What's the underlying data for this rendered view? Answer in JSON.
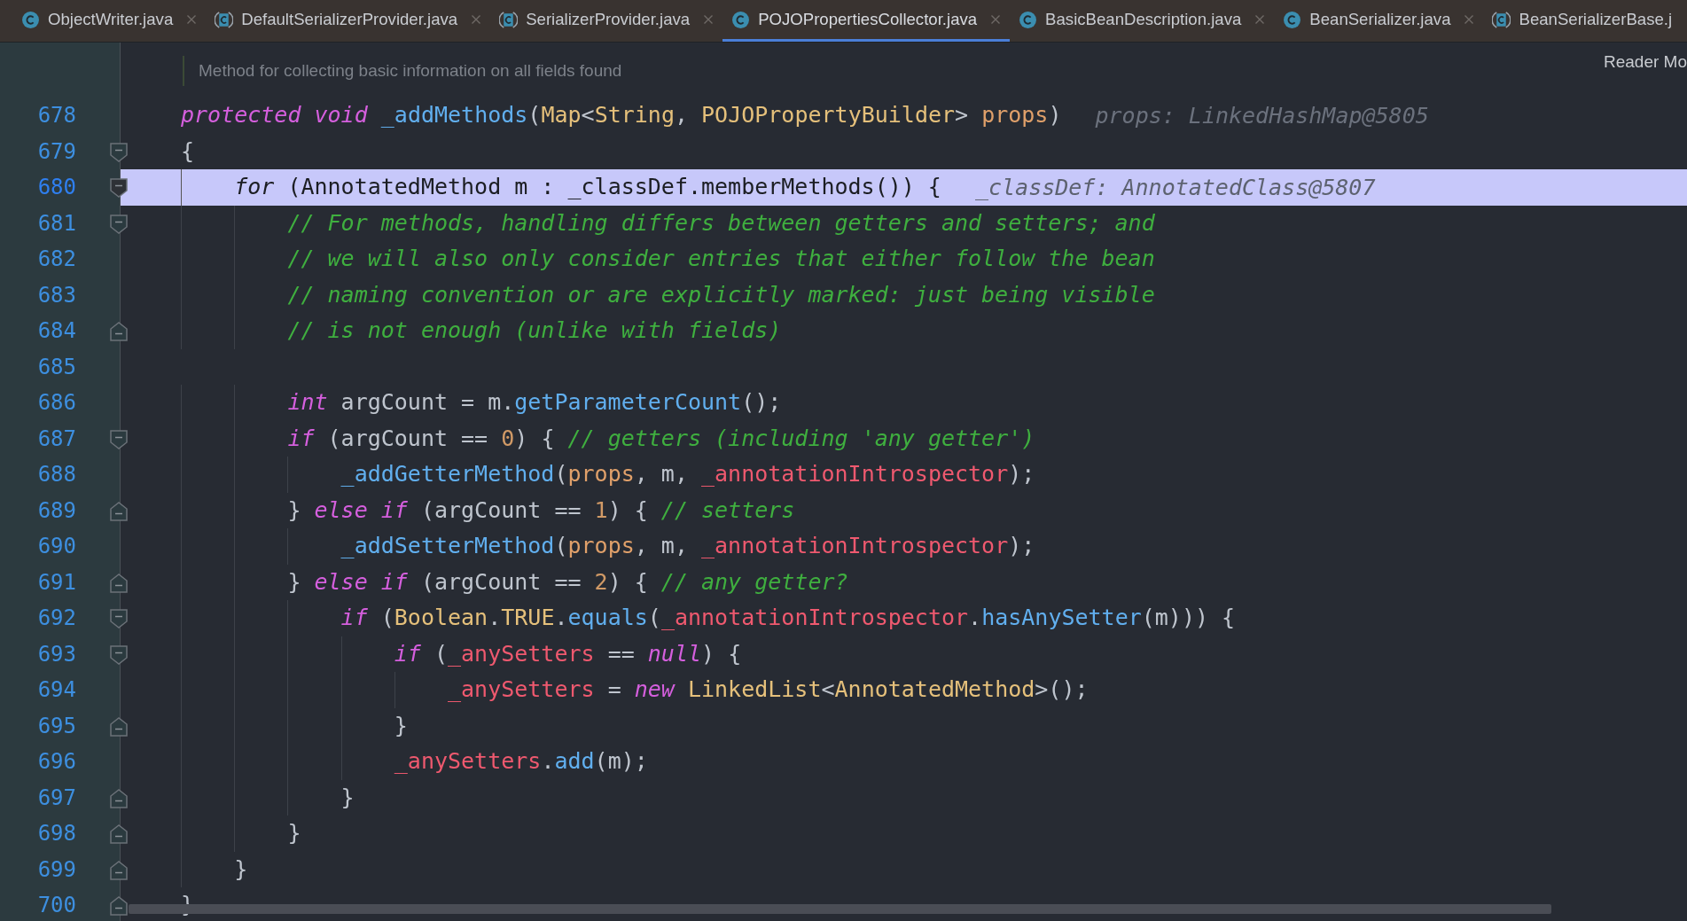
{
  "tabs": [
    {
      "label": "ObjectWriter.java",
      "kind": "class",
      "selected": false,
      "closable": true
    },
    {
      "label": "DefaultSerializerProvider.java",
      "kind": "library",
      "selected": false,
      "closable": true
    },
    {
      "label": "SerializerProvider.java",
      "kind": "library",
      "selected": false,
      "closable": true
    },
    {
      "label": "POJOPropertiesCollector.java",
      "kind": "class",
      "selected": true,
      "closable": true
    },
    {
      "label": "BasicBeanDescription.java",
      "kind": "class",
      "selected": false,
      "closable": true
    },
    {
      "label": "BeanSerializer.java",
      "kind": "class",
      "selected": false,
      "closable": true
    },
    {
      "label": "BeanSerializerBase.j",
      "kind": "library",
      "selected": false,
      "closable": false
    }
  ],
  "doc_comment": "Method for collecting basic information on all fields found",
  "reader_mode": "Reader Mo",
  "lines": [
    {
      "number": "678",
      "kind": "plain",
      "current": false,
      "tokens": [
        {
          "kind": "keyword",
          "text": "protected "
        },
        {
          "kind": "keyword",
          "text": "void "
        },
        {
          "kind": "method",
          "text": "_addMethods"
        },
        {
          "kind": "plain",
          "text": "("
        },
        {
          "kind": "type",
          "text": "Map"
        },
        {
          "kind": "plain",
          "text": "<"
        },
        {
          "kind": "type",
          "text": "String"
        },
        {
          "kind": "plain",
          "text": ", "
        },
        {
          "kind": "type",
          "text": "POJOPropertyBuilder"
        },
        {
          "kind": "plain",
          "text": "> "
        },
        {
          "kind": "param",
          "text": "props"
        },
        {
          "kind": "plain",
          "text": ")"
        }
      ],
      "hint": "props: LinkedHashMap@5805"
    },
    {
      "number": "679",
      "kind": "opener",
      "current": false,
      "tokens": [
        {
          "kind": "plain",
          "text": "{"
        }
      ]
    },
    {
      "number": "680",
      "kind": "opener",
      "current": true,
      "tokens": [
        {
          "kind": "keyword",
          "text": "    for"
        },
        {
          "kind": "plain",
          "text": " (AnnotatedMethod m : _classDef.memberMethods()) {"
        }
      ],
      "hint": "_classDef: AnnotatedClass@5807"
    },
    {
      "number": "681",
      "kind": "opener",
      "current": false,
      "tokens": [
        {
          "kind": "comment",
          "text": "        // For methods, handling differs between getters and setters; and"
        }
      ]
    },
    {
      "number": "682",
      "kind": "plain",
      "current": false,
      "tokens": [
        {
          "kind": "comment",
          "text": "        // we will also only consider entries that either follow the bean"
        }
      ]
    },
    {
      "number": "683",
      "kind": "plain",
      "current": false,
      "tokens": [
        {
          "kind": "comment",
          "text": "        // naming convention or are explicitly marked: just being visible"
        }
      ]
    },
    {
      "number": "684",
      "kind": "closer",
      "current": false,
      "tokens": [
        {
          "kind": "comment",
          "text": "        // is not enough (unlike with fields)"
        }
      ]
    },
    {
      "number": "685",
      "kind": "plain",
      "current": false
    },
    {
      "number": "686",
      "kind": "plain",
      "current": false,
      "tokens": [
        {
          "kind": "keyword",
          "text": "        int"
        },
        {
          "kind": "plain",
          "text": " argCount = m."
        },
        {
          "kind": "method",
          "text": "getParameterCount"
        },
        {
          "kind": "plain",
          "text": "();"
        }
      ]
    },
    {
      "number": "687",
      "kind": "opener",
      "current": false,
      "tokens": [
        {
          "kind": "keyword",
          "text": "        if"
        },
        {
          "kind": "plain",
          "text": " (argCount == "
        },
        {
          "kind": "number",
          "text": "0"
        },
        {
          "kind": "plain",
          "text": ") { "
        },
        {
          "kind": "comment",
          "text": "// getters (including 'any getter')"
        }
      ]
    },
    {
      "number": "688",
      "kind": "plain",
      "current": false,
      "tokens": [
        {
          "kind": "method",
          "text": "            _addGetterMethod"
        },
        {
          "kind": "plain",
          "text": "("
        },
        {
          "kind": "param",
          "text": "props"
        },
        {
          "kind": "plain",
          "text": ", m, "
        },
        {
          "kind": "field",
          "text": "_annotationIntrospector"
        },
        {
          "kind": "plain",
          "text": ");"
        }
      ]
    },
    {
      "number": "689",
      "kind": "closer",
      "current": false,
      "tokens": [
        {
          "kind": "plain",
          "text": "        } "
        },
        {
          "kind": "keyword",
          "text": "else if"
        },
        {
          "kind": "plain",
          "text": " (argCount == "
        },
        {
          "kind": "number",
          "text": "1"
        },
        {
          "kind": "plain",
          "text": ") { "
        },
        {
          "kind": "comment",
          "text": "// setters"
        }
      ]
    },
    {
      "number": "690",
      "kind": "plain",
      "current": false,
      "tokens": [
        {
          "kind": "method",
          "text": "            _addSetterMethod"
        },
        {
          "kind": "plain",
          "text": "("
        },
        {
          "kind": "param",
          "text": "props"
        },
        {
          "kind": "plain",
          "text": ", m, "
        },
        {
          "kind": "field",
          "text": "_annotationIntrospector"
        },
        {
          "kind": "plain",
          "text": ");"
        }
      ]
    },
    {
      "number": "691",
      "kind": "closer",
      "current": false,
      "tokens": [
        {
          "kind": "plain",
          "text": "        } "
        },
        {
          "kind": "keyword",
          "text": "else if"
        },
        {
          "kind": "plain",
          "text": " (argCount == "
        },
        {
          "kind": "number",
          "text": "2"
        },
        {
          "kind": "plain",
          "text": ") { "
        },
        {
          "kind": "comment",
          "text": "// any getter?"
        }
      ]
    },
    {
      "number": "692",
      "kind": "opener",
      "current": false,
      "tokens": [
        {
          "kind": "keyword",
          "text": "            if"
        },
        {
          "kind": "plain",
          "text": " ("
        },
        {
          "kind": "type",
          "text": "Boolean"
        },
        {
          "kind": "plain",
          "text": "."
        },
        {
          "kind": "type",
          "text": "TRUE"
        },
        {
          "kind": "plain",
          "text": "."
        },
        {
          "kind": "method",
          "text": "equals"
        },
        {
          "kind": "plain",
          "text": "("
        },
        {
          "kind": "field",
          "text": "_annotationIntrospector"
        },
        {
          "kind": "plain",
          "text": "."
        },
        {
          "kind": "method",
          "text": "hasAnySetter"
        },
        {
          "kind": "plain",
          "text": "(m))) {"
        }
      ]
    },
    {
      "number": "693",
      "kind": "opener",
      "current": false,
      "tokens": [
        {
          "kind": "keyword",
          "text": "                if"
        },
        {
          "kind": "plain",
          "text": " ("
        },
        {
          "kind": "field",
          "text": "_anySetters"
        },
        {
          "kind": "plain",
          "text": " == "
        },
        {
          "kind": "keyword",
          "text": "null"
        },
        {
          "kind": "plain",
          "text": ") {"
        }
      ]
    },
    {
      "number": "694",
      "kind": "plain",
      "current": false,
      "tokens": [
        {
          "kind": "field",
          "text": "                    _anySetters"
        },
        {
          "kind": "plain",
          "text": " = "
        },
        {
          "kind": "keyword",
          "text": "new "
        },
        {
          "kind": "type",
          "text": "LinkedList"
        },
        {
          "kind": "plain",
          "text": "<"
        },
        {
          "kind": "type",
          "text": "AnnotatedMethod"
        },
        {
          "kind": "plain",
          "text": ">();"
        }
      ]
    },
    {
      "number": "695",
      "kind": "closer",
      "current": false,
      "tokens": [
        {
          "kind": "plain",
          "text": "                }"
        }
      ]
    },
    {
      "number": "696",
      "kind": "plain",
      "current": false,
      "tokens": [
        {
          "kind": "field",
          "text": "                _anySetters"
        },
        {
          "kind": "plain",
          "text": "."
        },
        {
          "kind": "method",
          "text": "add"
        },
        {
          "kind": "plain",
          "text": "(m);"
        }
      ]
    },
    {
      "number": "697",
      "kind": "closer",
      "current": false,
      "tokens": [
        {
          "kind": "plain",
          "text": "            }"
        }
      ]
    },
    {
      "number": "698",
      "kind": "closer",
      "current": false,
      "tokens": [
        {
          "kind": "plain",
          "text": "        }"
        }
      ]
    },
    {
      "number": "699",
      "kind": "closer",
      "current": false,
      "tokens": [
        {
          "kind": "plain",
          "text": "    }"
        }
      ]
    },
    {
      "number": "700",
      "kind": "closer",
      "current": false,
      "tokens": [
        {
          "kind": "plain",
          "text": "}"
        }
      ]
    }
  ]
}
